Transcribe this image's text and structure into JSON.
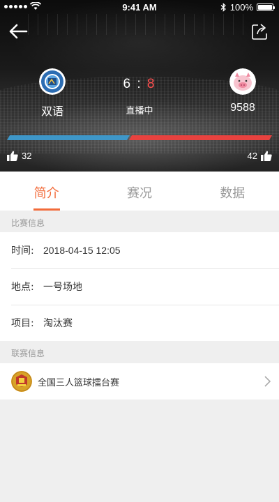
{
  "status_bar": {
    "time": "9:41 AM",
    "battery": "100%"
  },
  "match": {
    "home_team": "双语",
    "away_team": "9588",
    "home_score": "6",
    "separator": ":",
    "away_score": "8",
    "status": "直播中",
    "home_likes": "32",
    "away_likes": "42",
    "home_share": 0.46,
    "away_share": 0.54
  },
  "tabs": [
    {
      "label": "简介",
      "active": true
    },
    {
      "label": "赛况",
      "active": false
    },
    {
      "label": "数据",
      "active": false
    }
  ],
  "match_info": {
    "section_title": "比赛信息",
    "rows": [
      {
        "label": "时间:",
        "value": "2018-04-15 12:05"
      },
      {
        "label": "地点:",
        "value": "一号场地"
      },
      {
        "label": "项目:",
        "value": "淘汰赛"
      }
    ]
  },
  "league_info": {
    "section_title": "联赛信息",
    "name": "全国三人篮球擂台赛"
  },
  "colors": {
    "accent": "#f26b3a",
    "home_bar": "#3e97c9",
    "away_bar": "#e8423f",
    "away_score": "#ff5050"
  }
}
